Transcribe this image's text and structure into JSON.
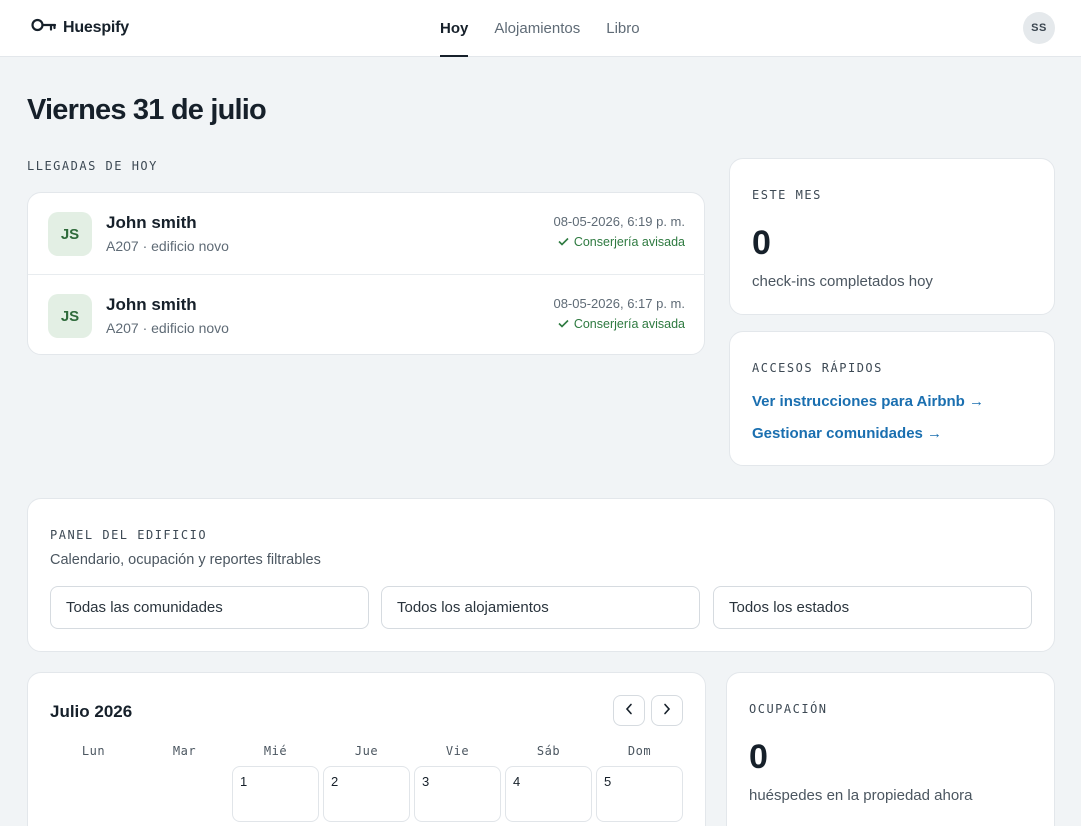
{
  "app": {
    "name": "Huespify"
  },
  "nav": {
    "tabs": [
      {
        "label": "Hoy",
        "active": true
      },
      {
        "label": "Alojamientos",
        "active": false
      },
      {
        "label": "Libro",
        "active": false
      }
    ],
    "user_initials": "SS"
  },
  "page": {
    "title": "Viernes 31 de julio"
  },
  "arrivals": {
    "label": "LLEGADAS DE HOY",
    "items": [
      {
        "initials": "JS",
        "name": "John smith",
        "unit": "A207 · edificio novo",
        "datetime": "08-05-2026, 6:19 p. m.",
        "status": "Conserjería avisada"
      },
      {
        "initials": "JS",
        "name": "John smith",
        "unit": "A207 · edificio novo",
        "datetime": "08-05-2026, 6:17 p. m.",
        "status": "Conserjería avisada"
      }
    ]
  },
  "this_month": {
    "label": "ESTE MES",
    "value": "0",
    "caption": "check-ins completados hoy"
  },
  "quick_access": {
    "label": "ACCESOS RÁPIDOS",
    "links": [
      {
        "label": "Ver instrucciones para Airbnb →"
      },
      {
        "label": "Gestionar comunidades →"
      }
    ]
  },
  "building_panel": {
    "label": "PANEL DEL EDIFICIO",
    "subtitle": "Calendario, ocupación y reportes filtrables",
    "filters": [
      {
        "value": "Todas las comunidades"
      },
      {
        "value": "Todos los alojamientos"
      },
      {
        "value": "Todos los estados"
      }
    ]
  },
  "calendar": {
    "title": "Julio 2026",
    "weekdays": [
      "Lun",
      "Mar",
      "Mié",
      "Jue",
      "Vie",
      "Sáb",
      "Dom"
    ],
    "first_row_days": [
      "1",
      "2",
      "3",
      "4",
      "5"
    ]
  },
  "occupancy": {
    "label": "OCUPACIÓN",
    "value": "0",
    "caption": "huéspedes en la propiedad ahora"
  },
  "colors": {
    "accent_link": "#1a6fb0",
    "success": "#2e7a40",
    "avatar_bg": "#e3efe4"
  },
  "icons": {
    "brand": "key-icon",
    "status": "check-icon",
    "prev": "chevron-left-icon",
    "next": "chevron-right-icon"
  }
}
